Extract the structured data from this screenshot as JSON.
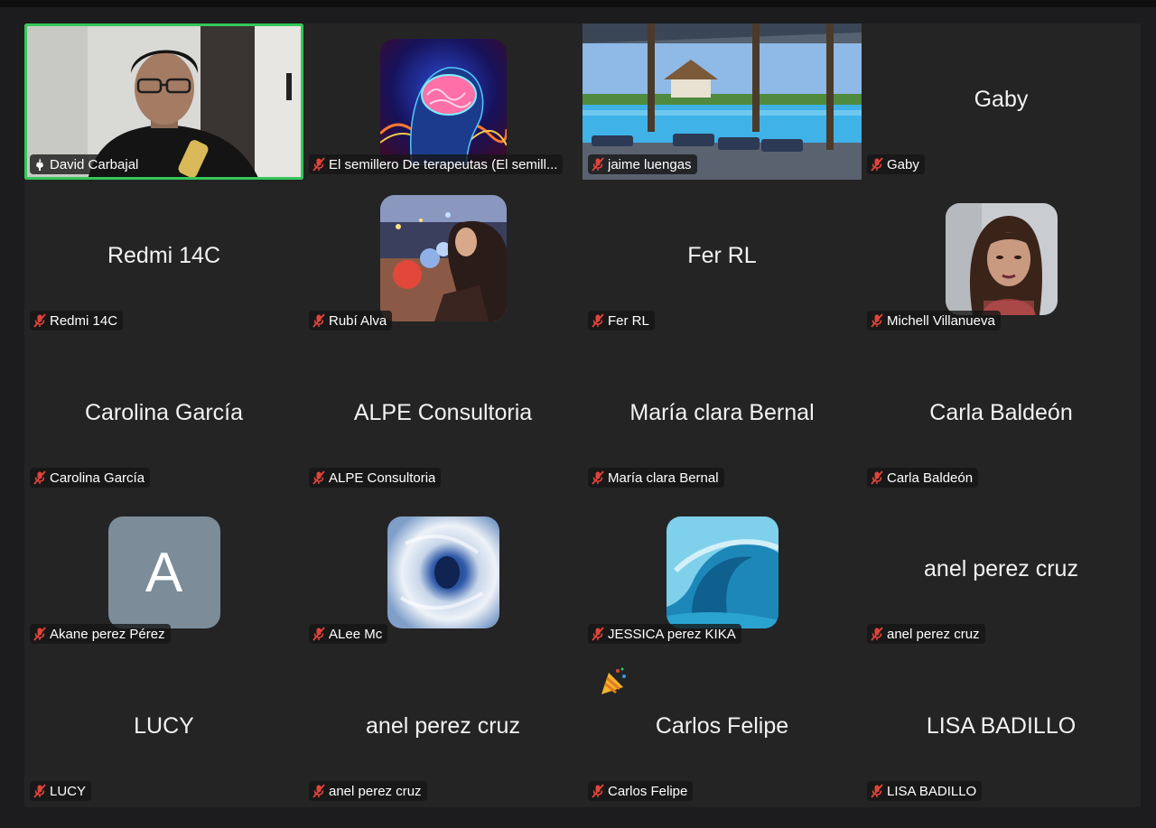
{
  "participants": [
    {
      "display": "",
      "label": "David Carbajal",
      "avatar": "video-feed",
      "active": true,
      "icon": "raised-hand-icon"
    },
    {
      "display": "",
      "label": "El semillero De terapeutas (El semill...",
      "avatar": "brain-avatar",
      "icon": "mic-muted-icon"
    },
    {
      "display": "",
      "label": "jaime luengas",
      "avatar": "pool-photo",
      "icon": "mic-muted-icon"
    },
    {
      "display": "Gaby",
      "label": "Gaby",
      "avatar": "none",
      "icon": "mic-muted-icon"
    },
    {
      "display": "Redmi 14C",
      "label": "Redmi 14C",
      "avatar": "none",
      "icon": "mic-muted-icon"
    },
    {
      "display": "",
      "label": "Rubí Alva",
      "avatar": "concert-photo",
      "icon": "mic-muted-icon"
    },
    {
      "display": "Fer RL",
      "label": "Fer RL",
      "avatar": "none",
      "icon": "mic-muted-icon"
    },
    {
      "display": "",
      "label": "Michell Villanueva",
      "avatar": "portrait-photo",
      "icon": "mic-muted-icon"
    },
    {
      "display": "Carolina García",
      "label": "Carolina García",
      "avatar": "none",
      "icon": "mic-muted-icon"
    },
    {
      "display": "ALPE Consultoria",
      "label": "ALPE Consultoria",
      "avatar": "none",
      "icon": "mic-muted-icon"
    },
    {
      "display": "María clara Bernal",
      "label": "María clara Bernal",
      "avatar": "none",
      "icon": "mic-muted-icon"
    },
    {
      "display": "Carla Baldeón",
      "label": "Carla Baldeón",
      "avatar": "none",
      "icon": "mic-muted-icon"
    },
    {
      "display": "A",
      "label": "Akane perez Pérez",
      "avatar": "letter-avatar",
      "icon": "mic-muted-icon"
    },
    {
      "display": "",
      "label": "ALee Mc",
      "avatar": "hurricane-photo",
      "icon": "mic-muted-icon"
    },
    {
      "display": "",
      "label": "JESSICA perez KIKA",
      "avatar": "wave-photo",
      "icon": "mic-muted-icon"
    },
    {
      "display": "anel perez cruz",
      "label": "anel perez cruz",
      "avatar": "none",
      "icon": "mic-muted-icon"
    },
    {
      "display": "LUCY",
      "label": "LUCY",
      "avatar": "none",
      "icon": "mic-muted-icon"
    },
    {
      "display": "anel perez cruz",
      "label": "anel perez cruz",
      "avatar": "none",
      "icon": "mic-muted-icon"
    },
    {
      "display": "Carlos Felipe",
      "label": "Carlos Felipe",
      "avatar": "none",
      "icon": "mic-muted-icon"
    },
    {
      "display": "LISA BADILLO",
      "label": "LISA BADILLO",
      "avatar": "none",
      "icon": "mic-muted-icon"
    }
  ],
  "colors": {
    "active_border": "#35c759",
    "muted_icon": "#e0443a",
    "letter_avatar_bg": "#7c8d99"
  },
  "reaction": "party-popper-icon"
}
